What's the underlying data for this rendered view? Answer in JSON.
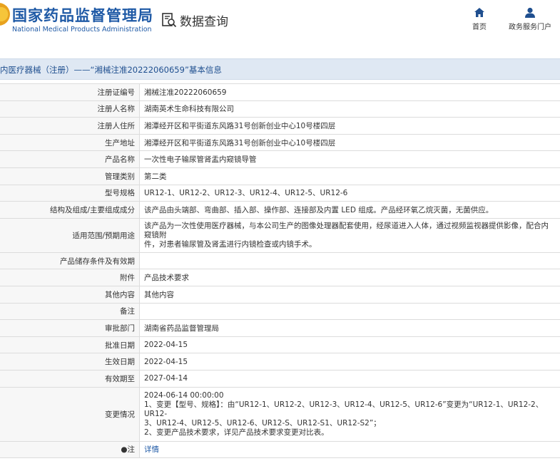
{
  "header": {
    "logo_cn": "国家药品监督管理局",
    "logo_en": "National Medical Products Administration",
    "query_label": "数据查询",
    "nav": [
      {
        "label": "首页",
        "icon": "home-icon"
      },
      {
        "label": "政务服务门户",
        "icon": "user-icon"
      }
    ]
  },
  "title": "内医疗器械（注册）——“湘械注准20222060659”基本信息",
  "rows": [
    {
      "label": "注册证编号",
      "value": "湘械注准20222060659"
    },
    {
      "label": "注册人名称",
      "value": "湖南英术生命科技有限公司"
    },
    {
      "label": "注册人住所",
      "value": "湘潭经开区和平街道东风路31号创新创业中心10号楼四层"
    },
    {
      "label": "生产地址",
      "value": "湘潭经开区和平街道东风路31号创新创业中心10号楼四层"
    },
    {
      "label": "产品名称",
      "value": "一次性电子输尿管肾盂内窥镜导管"
    },
    {
      "label": "管理类别",
      "value": "第二类"
    },
    {
      "label": "型号规格",
      "value": "UR12-1、UR12-2、UR12-3、UR12-4、UR12-5、UR12-6"
    },
    {
      "label": "结构及组成/主要组成成分",
      "value": "该产品由头端部、弯曲部、插入部、操作部、连接部及内置 LED 组成。产品经环氧乙烷灭菌，无菌供应。"
    },
    {
      "label": "适用范围/预期用途",
      "lines": [
        "该产品为一次性使用医疗器械，与本公司生产的图像处理器配套使用，经尿道进入人体，通过视频监视器提供影像，配合内窥镜附",
        "件，对患者输尿管及肾盂进行内镜检查或内镜手术。"
      ]
    },
    {
      "label": "产品储存条件及有效期",
      "value": ""
    },
    {
      "label": "附件",
      "value": "产品技术要求"
    },
    {
      "label": "其他内容",
      "value": "其他内容"
    },
    {
      "label": "备注",
      "value": ""
    },
    {
      "label": "审批部门",
      "value": "湖南省药品监督管理局"
    },
    {
      "label": "批准日期",
      "value": "2022-04-15"
    },
    {
      "label": "生效日期",
      "value": "2022-04-15"
    },
    {
      "label": "有效期至",
      "value": "2027-04-14"
    },
    {
      "label": "变更情况",
      "lines": [
        "2024-06-14 00:00:00",
        "1、变更【型号、规格】：由“UR12-1、UR12-2、UR12-3、UR12-4、UR12-5、UR12-6”变更为“UR12-1、UR12-2、UR12-",
        "3、UR12-4、UR12-5、UR12-6、UR12-S、UR12-S1、UR12-S2”；",
        "2、变更产品技术要求，详见产品技术要求变更对比表。"
      ]
    },
    {
      "label": "●注",
      "value": "详情"
    }
  ]
}
